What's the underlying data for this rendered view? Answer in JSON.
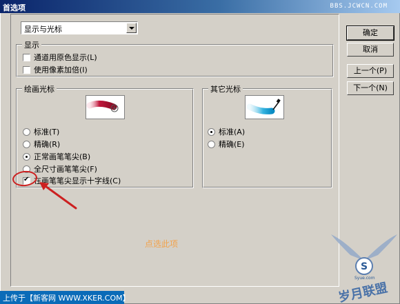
{
  "window": {
    "title": "首选项",
    "watermark": "BBS.JCWCN.COM"
  },
  "category_select": {
    "value": "显示与光标"
  },
  "display_group": {
    "legend": "显示",
    "items": [
      {
        "label": "通道用原色显示(L)",
        "checked": false
      },
      {
        "label": "使用像素加倍(I)",
        "checked": false
      }
    ]
  },
  "painting_cursors": {
    "legend": "绘画光标",
    "options": [
      {
        "label": "标准(T)",
        "checked": false
      },
      {
        "label": "精确(R)",
        "checked": false
      },
      {
        "label": "正常画笔笔尖(B)",
        "checked": true
      },
      {
        "label": "全尺寸画笔笔尖(F)",
        "checked": false
      }
    ],
    "crosshair": {
      "label": "在画笔笔尖显示十字线(C)",
      "checked": true
    }
  },
  "other_cursors": {
    "legend": "其它光标",
    "options": [
      {
        "label": "标准(A)",
        "checked": true
      },
      {
        "label": "精确(E)",
        "checked": false
      }
    ]
  },
  "buttons": {
    "ok": "确定",
    "cancel": "取消",
    "prev": "上一个(P)",
    "next": "下一个(N)"
  },
  "hint_text": "点选此项",
  "footer_text": "上传于【新客网 WWW.XKER.COM】",
  "logo_text": "岁月联盟",
  "logo_sub": "Syue.com",
  "colors": {
    "annotation": "#cc2020",
    "hint": "#f2a24b",
    "titlebar": "#0a246a"
  }
}
